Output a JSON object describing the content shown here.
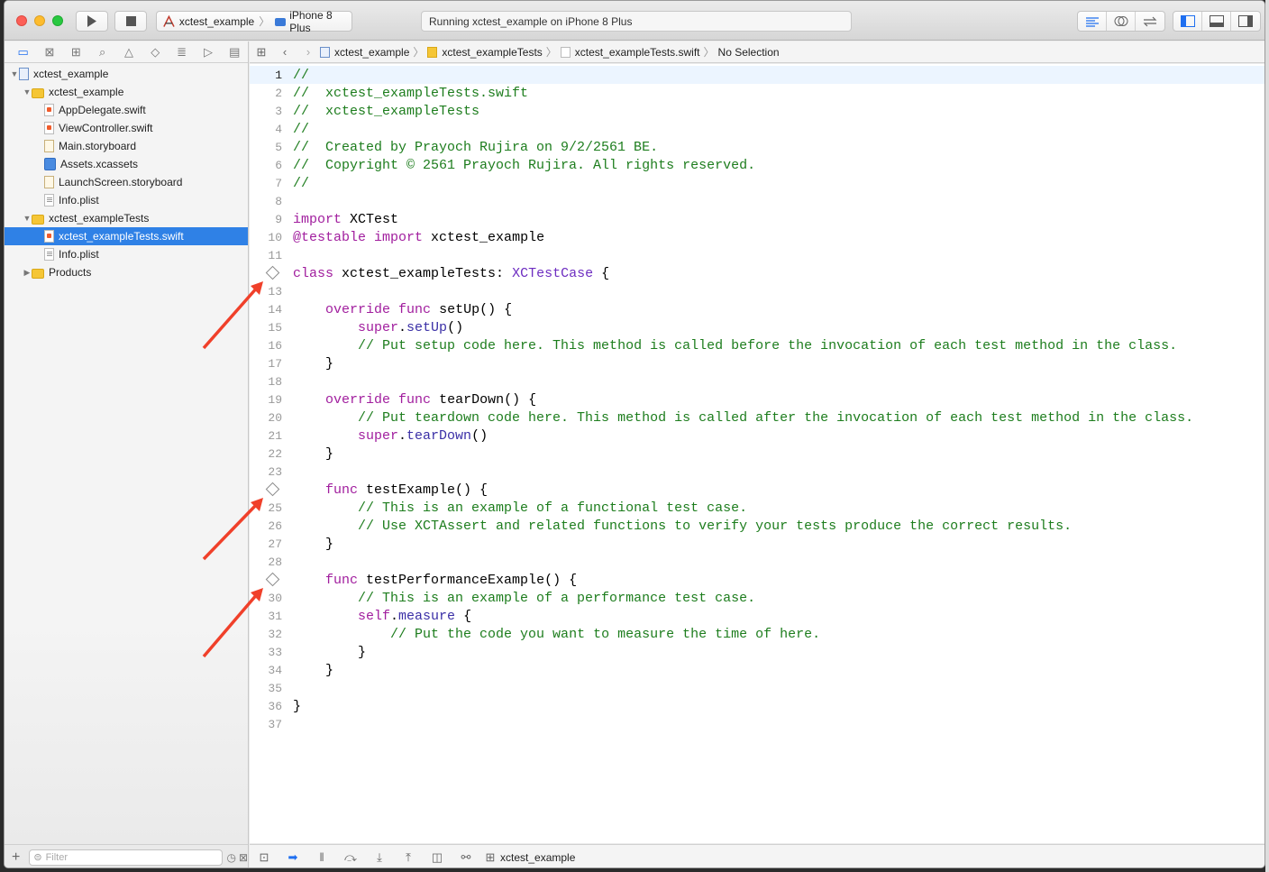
{
  "toolbar": {
    "scheme_target": "xctest_example",
    "scheme_device": "iPhone 8 Plus",
    "status_text": "Running xctest_example on iPhone 8 Plus"
  },
  "navigator": {
    "filter_placeholder": "Filter",
    "items": [
      {
        "label": "xctest_example",
        "level": 0,
        "icon": "project-icon",
        "disclosure": "open"
      },
      {
        "label": "xctest_example",
        "level": 1,
        "icon": "folder-icon",
        "disclosure": "open"
      },
      {
        "label": "AppDelegate.swift",
        "level": 2,
        "icon": "swift-file-icon"
      },
      {
        "label": "ViewController.swift",
        "level": 2,
        "icon": "swift-file-icon"
      },
      {
        "label": "Main.storyboard",
        "level": 2,
        "icon": "storyboard-icon"
      },
      {
        "label": "Assets.xcassets",
        "level": 2,
        "icon": "assets-icon"
      },
      {
        "label": "LaunchScreen.storyboard",
        "level": 2,
        "icon": "storyboard-icon"
      },
      {
        "label": "Info.plist",
        "level": 2,
        "icon": "plist-icon"
      },
      {
        "label": "xctest_exampleTests",
        "level": 1,
        "icon": "folder-icon",
        "disclosure": "open"
      },
      {
        "label": "xctest_exampleTests.swift",
        "level": 2,
        "icon": "swift-file-icon",
        "selected": true
      },
      {
        "label": "Info.plist",
        "level": 2,
        "icon": "plist-icon"
      },
      {
        "label": "Products",
        "level": 1,
        "icon": "folder-icon",
        "disclosure": "closed"
      }
    ]
  },
  "jumpbar": {
    "crumbs": [
      "xctest_example",
      "xctest_exampleTests",
      "xctest_exampleTests.swift",
      "No Selection"
    ]
  },
  "editor": {
    "lines": [
      {
        "n": "1",
        "html": "<span class=\"c-comment\">//</span>"
      },
      {
        "n": "2",
        "html": "<span class=\"c-comment\">//  xctest_exampleTests.swift</span>"
      },
      {
        "n": "3",
        "html": "<span class=\"c-comment\">//  xctest_exampleTests</span>"
      },
      {
        "n": "4",
        "html": "<span class=\"c-comment\">//</span>"
      },
      {
        "n": "5",
        "html": "<span class=\"c-comment\">//  Created by Prayoch Rujira on 9/2/2561 BE.</span>"
      },
      {
        "n": "6",
        "html": "<span class=\"c-comment\">//  Copyright © 2561 Prayoch Rujira. All rights reserved.</span>"
      },
      {
        "n": "7",
        "html": "<span class=\"c-comment\">//</span>"
      },
      {
        "n": "8",
        "html": ""
      },
      {
        "n": "9",
        "html": "<span class=\"c-key\">import</span> XCTest"
      },
      {
        "n": "10",
        "html": "<span class=\"c-key\">@testable</span> <span class=\"c-key\">import</span> xctest_example"
      },
      {
        "n": "11",
        "html": ""
      },
      {
        "n": "",
        "html": "<span class=\"c-key\">class</span> xctest_exampleTests: <span class=\"c-type\">XCTestCase</span> {",
        "test_diamond": true
      },
      {
        "n": "13",
        "html": ""
      },
      {
        "n": "14",
        "html": "    <span class=\"c-key\">override</span> <span class=\"c-key\">func</span> setUp() {"
      },
      {
        "n": "15",
        "html": "        <span class=\"c-key\">super</span>.<span class=\"c-fn\">setUp</span>()"
      },
      {
        "n": "16",
        "html": "        <span class=\"c-comment\">// Put setup code here. This method is called before the invocation of each test method in the class.</span>"
      },
      {
        "n": "17",
        "html": "    }"
      },
      {
        "n": "18",
        "html": ""
      },
      {
        "n": "19",
        "html": "    <span class=\"c-key\">override</span> <span class=\"c-key\">func</span> tearDown() {"
      },
      {
        "n": "20",
        "html": "        <span class=\"c-comment\">// Put teardown code here. This method is called after the invocation of each test method in the class.</span>"
      },
      {
        "n": "21",
        "html": "        <span class=\"c-key\">super</span>.<span class=\"c-fn\">tearDown</span>()"
      },
      {
        "n": "22",
        "html": "    }"
      },
      {
        "n": "23",
        "html": ""
      },
      {
        "n": "",
        "html": "    <span class=\"c-key\">func</span> testExample() {",
        "test_diamond": true
      },
      {
        "n": "25",
        "html": "        <span class=\"c-comment\">// This is an example of a functional test case.</span>"
      },
      {
        "n": "26",
        "html": "        <span class=\"c-comment\">// Use XCTAssert and related functions to verify your tests produce the correct results.</span>"
      },
      {
        "n": "27",
        "html": "    }"
      },
      {
        "n": "28",
        "html": ""
      },
      {
        "n": "",
        "html": "    <span class=\"c-key\">func</span> testPerformanceExample() {",
        "test_diamond": true
      },
      {
        "n": "30",
        "html": "        <span class=\"c-comment\">// This is an example of a performance test case.</span>"
      },
      {
        "n": "31",
        "html": "        <span class=\"c-key\">self</span>.<span class=\"c-fn\">measure</span> {"
      },
      {
        "n": "32",
        "html": "            <span class=\"c-comment\">// Put the code you want to measure the time of here.</span>"
      },
      {
        "n": "33",
        "html": "        }"
      },
      {
        "n": "34",
        "html": "    }"
      },
      {
        "n": "35",
        "html": ""
      },
      {
        "n": "36",
        "html": "}"
      },
      {
        "n": "37",
        "html": ""
      }
    ]
  },
  "debugbar": {
    "target": "xctest_example"
  },
  "colors": {
    "selection": "#2f81e6",
    "comment": "#1d7d1d",
    "keyword": "#a11e9e",
    "annotation_arrow": "#f0402a"
  }
}
